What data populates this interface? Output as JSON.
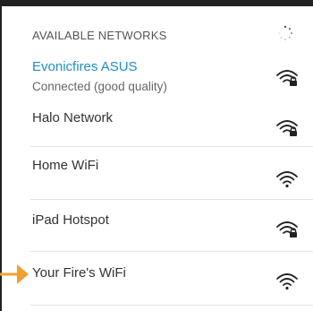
{
  "header": {
    "title": "AVAILABLE NETWORKS"
  },
  "networks": [
    {
      "name": "Evonicfires ASUS",
      "status": "Connected (good quality)",
      "secured": true,
      "connected": true
    },
    {
      "name": "Halo Network",
      "secured": true
    },
    {
      "name": "Home WiFi",
      "secured": false
    },
    {
      "name": "iPad Hotspot",
      "secured": true
    },
    {
      "name": "Your Fire's WiFi",
      "secured": false
    }
  ],
  "icons": {
    "scan": "loading-spinner-icon",
    "wifi_secured": "wifi-lock-icon",
    "wifi_open": "wifi-icon",
    "pointer": "orange-arrow-icon"
  },
  "colors": {
    "accent": "#1e8fc7",
    "pointer": "#f0a030"
  }
}
